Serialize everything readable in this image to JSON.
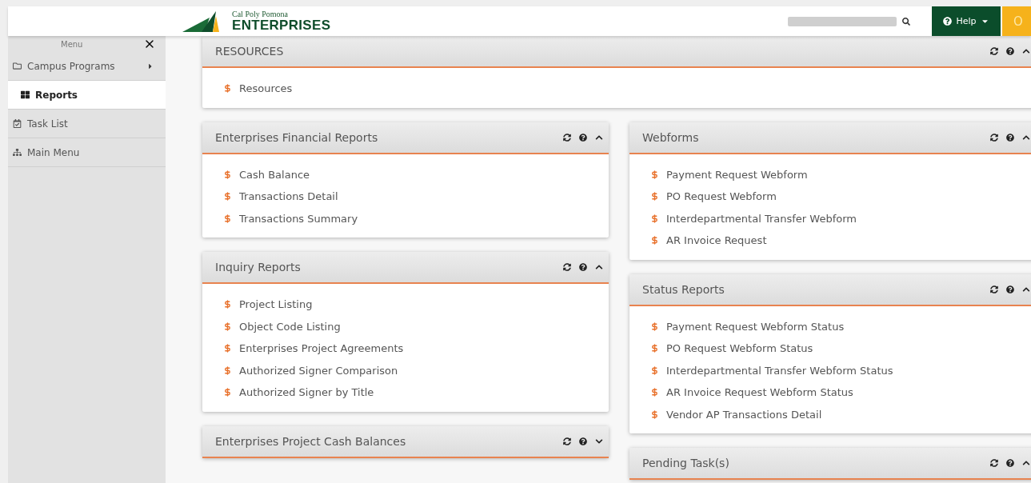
{
  "header": {
    "logo": {
      "line_1": "Cal Poly Pomona",
      "line_2": "ENTERPRISES"
    },
    "help_button": "Help",
    "user_button": "O"
  },
  "sidebar": {
    "title": "Menu",
    "items": [
      {
        "kind": "folder",
        "label": "Campus Programs",
        "selected": false,
        "has_submenu": true
      },
      {
        "kind": "grid",
        "label": "Reports",
        "selected": true,
        "has_submenu": false
      },
      {
        "kind": "calendar",
        "label": "Task List",
        "selected": false,
        "has_submenu": false
      },
      {
        "kind": "sitemap",
        "label": "Main Menu",
        "selected": false,
        "has_submenu": false
      }
    ]
  },
  "panels": {
    "top": [
      {
        "title": "RESOURCES",
        "expanded": true,
        "items": [
          "Resources"
        ]
      }
    ],
    "left": [
      {
        "title": "Enterprises Financial Reports",
        "expanded": true,
        "items": [
          "Cash Balance",
          "Transactions Detail",
          "Transactions Summary"
        ]
      },
      {
        "title": "Inquiry Reports",
        "expanded": true,
        "items": [
          "Project Listing",
          "Object Code Listing",
          "Enterprises Project Agreements",
          "Authorized Signer Comparison",
          "Authorized Signer by Title"
        ]
      },
      {
        "title": "Enterprises Project Cash Balances",
        "expanded": false
      }
    ],
    "right": [
      {
        "title": "Webforms",
        "expanded": true,
        "items": [
          "Payment Request Webform",
          "PO Request Webform",
          "Interdepartmental Transfer Webform",
          "AR Invoice Request"
        ]
      },
      {
        "title": "Status Reports",
        "expanded": true,
        "items": [
          "Payment Request Webform Status",
          "PO Request Webform Status",
          "Interdepartmental Transfer Webform Status",
          "AR Invoice Request Webform Status",
          "Vendor AP Transactions Detail"
        ]
      },
      {
        "title": "Pending Task(s)",
        "expanded": true
      }
    ]
  }
}
